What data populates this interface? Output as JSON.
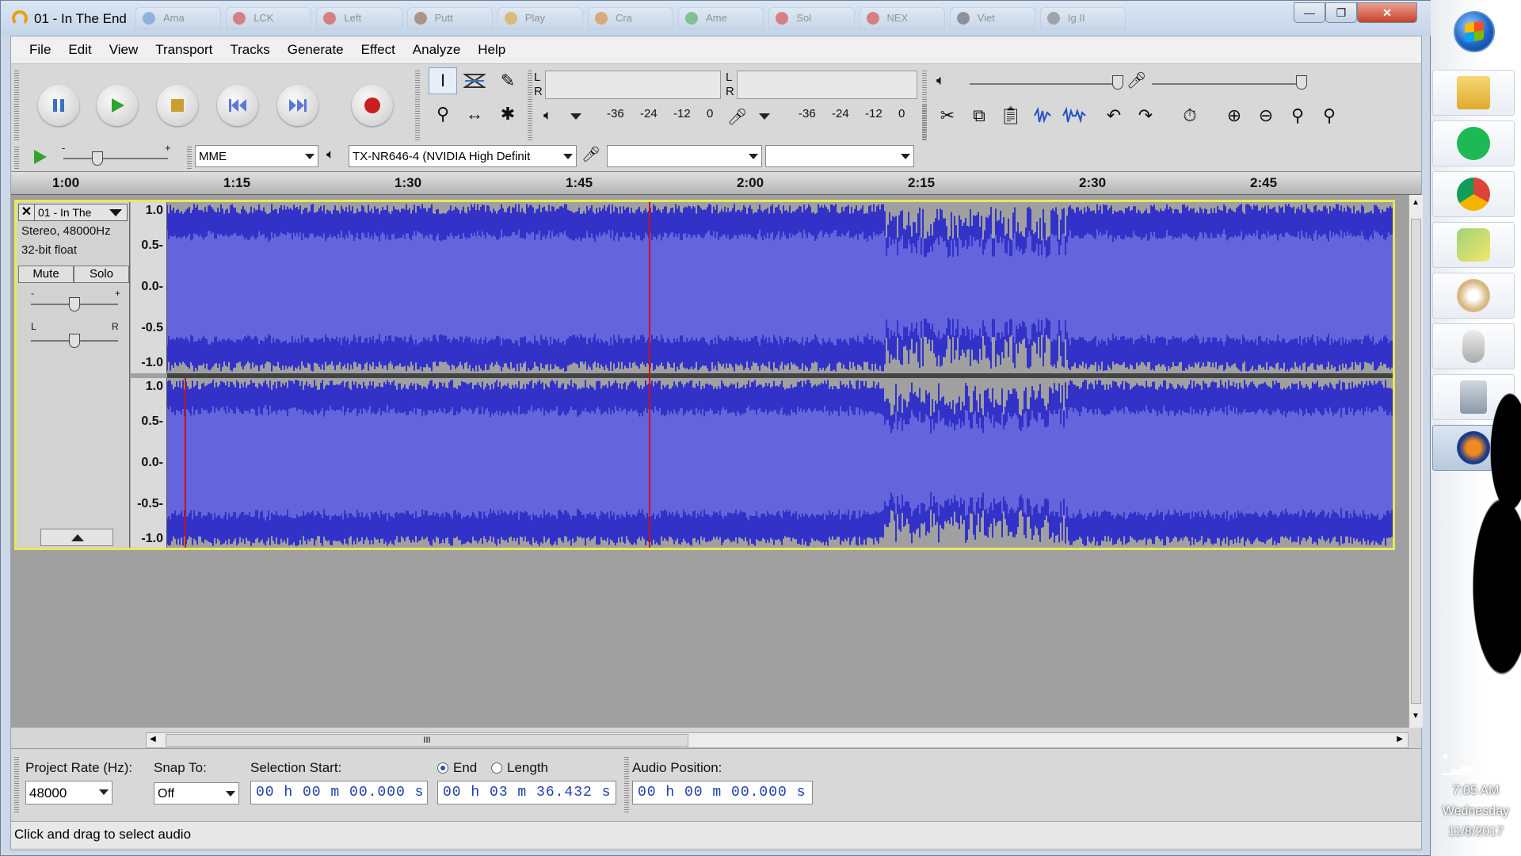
{
  "window": {
    "title": "01 - In The End",
    "ghost_tabs": [
      "Ama",
      "LCK",
      "Left",
      "Putt",
      "Play",
      "Cra",
      "Ame",
      "Sol",
      "NEX",
      "Viet",
      "Ig II"
    ],
    "controls": {
      "minimize": "—",
      "restore": "❐",
      "close": "✕"
    }
  },
  "menu": [
    "File",
    "Edit",
    "View",
    "Transport",
    "Tracks",
    "Generate",
    "Effect",
    "Analyze",
    "Help"
  ],
  "meters": {
    "play_left": "L",
    "play_right": "R",
    "rec_left": "L",
    "rec_right": "R",
    "play_scale": [
      "-36",
      "-24",
      "-12",
      "0"
    ],
    "rec_scale": [
      "-36",
      "-24",
      "-12",
      "0"
    ]
  },
  "device": {
    "host": "MME",
    "output": "TX-NR646-4 (NVIDIA High Definit",
    "input": "",
    "channels": ""
  },
  "slider_signs": {
    "minus": "-",
    "plus": "+",
    "left": "L",
    "right": "R"
  },
  "timeline": {
    "labels": [
      "1:00",
      "1:15",
      "1:30",
      "1:45",
      "2:00",
      "2:15",
      "2:30",
      "2:45"
    ]
  },
  "track": {
    "name": "01 - In The",
    "format": "Stereo, 48000Hz",
    "sample_type": "32-bit float",
    "mute": "Mute",
    "solo": "Solo",
    "ruler_top": [
      "1.0",
      "0.5-",
      "0.0-",
      "-0.5",
      "-1.0"
    ],
    "ruler_bottom": [
      "1.0",
      "0.5-",
      "0.0-",
      "-0.5-",
      "-1.0"
    ]
  },
  "hscroll_grip": "III",
  "selection_toolbar": {
    "project_rate_label": "Project Rate (Hz):",
    "project_rate": "48000",
    "snap_to_label": "Snap To:",
    "snap_to": "Off",
    "selection_start_label": "Selection Start:",
    "selection_start": "00 h 00 m 00.000 s",
    "end_label": "End",
    "length_label": "Length",
    "end_value": "00 h 03 m 36.432 s",
    "audio_position_label": "Audio Position:",
    "audio_position": "00 h 00 m 00.000 s"
  },
  "status": "Click and drag to select audio",
  "clock": {
    "time": "7:05 AM",
    "day": "Wednesday",
    "date": "11/8/2017"
  },
  "colors": {
    "waveform": "#3232c8",
    "waveform_rms": "#6464dc",
    "track_bg": "#a0a0a0",
    "selection_border": "#e8e85a",
    "cursor": "#d01010"
  }
}
